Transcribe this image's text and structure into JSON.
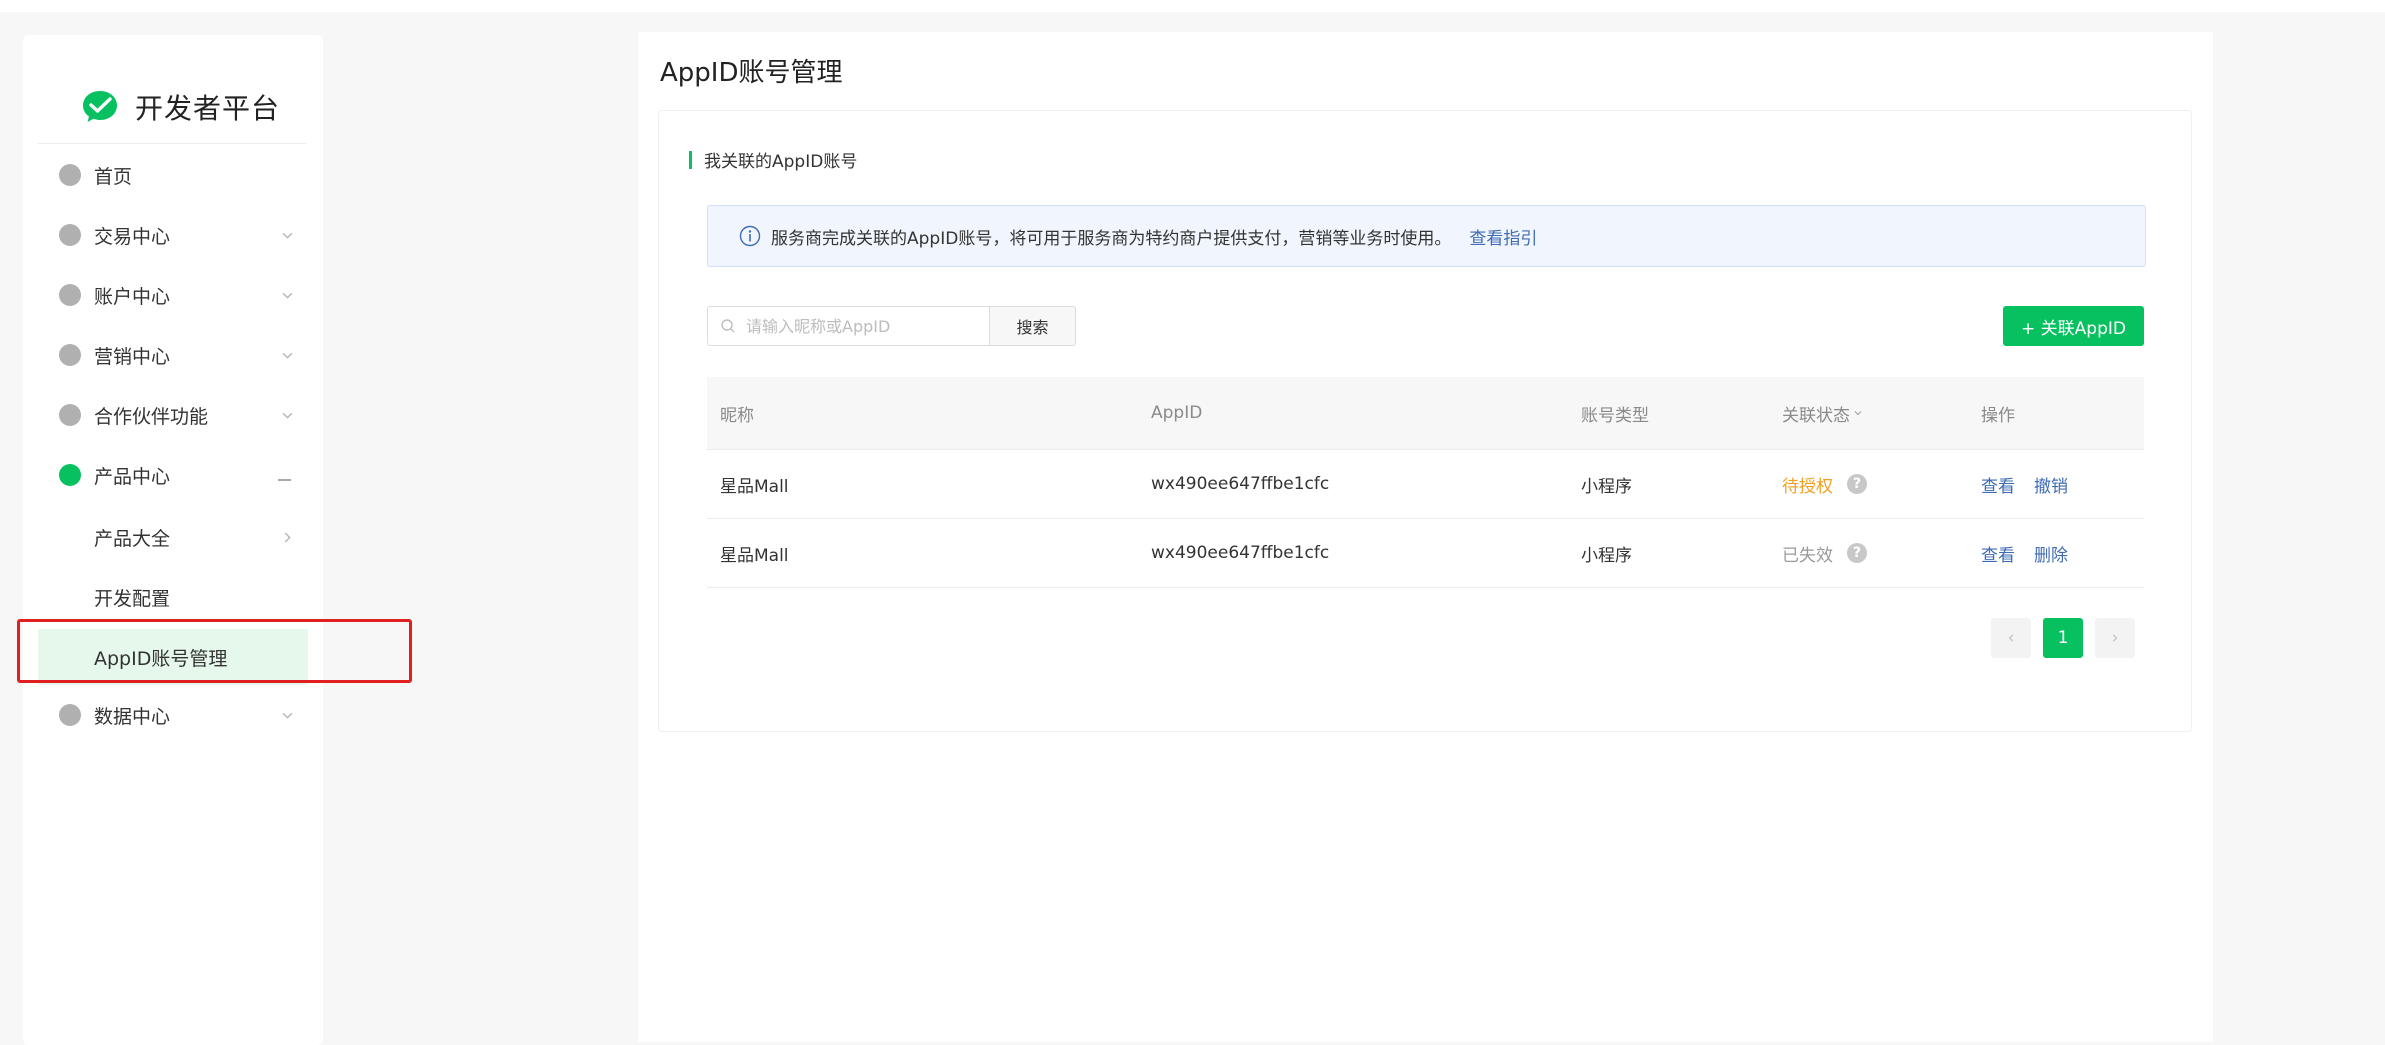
{
  "brand": {
    "title": "开发者平台",
    "logo_icon": "wechat-pay-logo"
  },
  "sidebar": {
    "items": [
      {
        "label": "首页"
      },
      {
        "label": "交易中心"
      },
      {
        "label": "账户中心"
      },
      {
        "label": "营销中心"
      },
      {
        "label": "合作伙伴功能"
      },
      {
        "label": "产品中心"
      },
      {
        "label": "数据中心"
      }
    ],
    "product_center_children": [
      {
        "label": "产品大全"
      },
      {
        "label": "开发配置"
      },
      {
        "label": "AppID账号管理",
        "active": true
      }
    ]
  },
  "main": {
    "title": "AppID账号管理",
    "section_title": "我关联的AppID账号",
    "notice": {
      "text": "服务商完成关联的AppID账号，将可用于服务商为特约商户提供支付，营销等业务时使用。",
      "link": "查看指引"
    },
    "search": {
      "placeholder": "请输入昵称或AppID",
      "button": "搜索"
    },
    "add_button": "+ 关联AppID",
    "table": {
      "headers": {
        "nickname": "昵称",
        "appid": "AppID",
        "type": "账号类型",
        "status": "关联状态",
        "actions": "操作"
      },
      "rows": [
        {
          "nickname": "星品Mall",
          "appid": "wx490ee647ffbe1cfc",
          "type": "小程序",
          "status": "待授权",
          "action1": "查看",
          "action2": "撤销"
        },
        {
          "nickname": "星品Mall",
          "appid": "wx490ee647ffbe1cfc",
          "type": "小程序",
          "status": "已失效",
          "action1": "查看",
          "action2": "删除"
        }
      ]
    },
    "pagination": {
      "prev": "‹",
      "current": "1",
      "next": "›"
    }
  },
  "colors": {
    "accent": "#07c160",
    "link": "#3e6bb4",
    "pending": "#f0a020",
    "highlight": "#e02020"
  }
}
